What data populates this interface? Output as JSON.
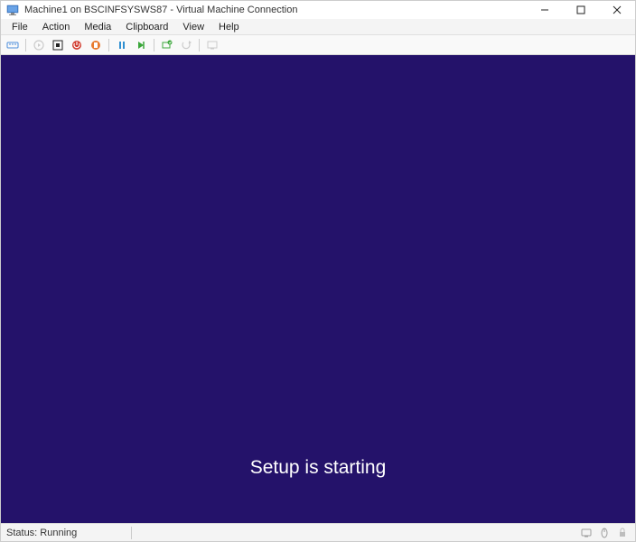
{
  "titlebar": {
    "title": "Machine1 on BSCINFSYSWS87 - Virtual Machine Connection"
  },
  "menus": {
    "file": "File",
    "action": "Action",
    "media": "Media",
    "clipboard": "Clipboard",
    "view": "View",
    "help": "Help"
  },
  "vm_screen": {
    "message": "Setup is starting"
  },
  "statusbar": {
    "status": "Status: Running"
  }
}
